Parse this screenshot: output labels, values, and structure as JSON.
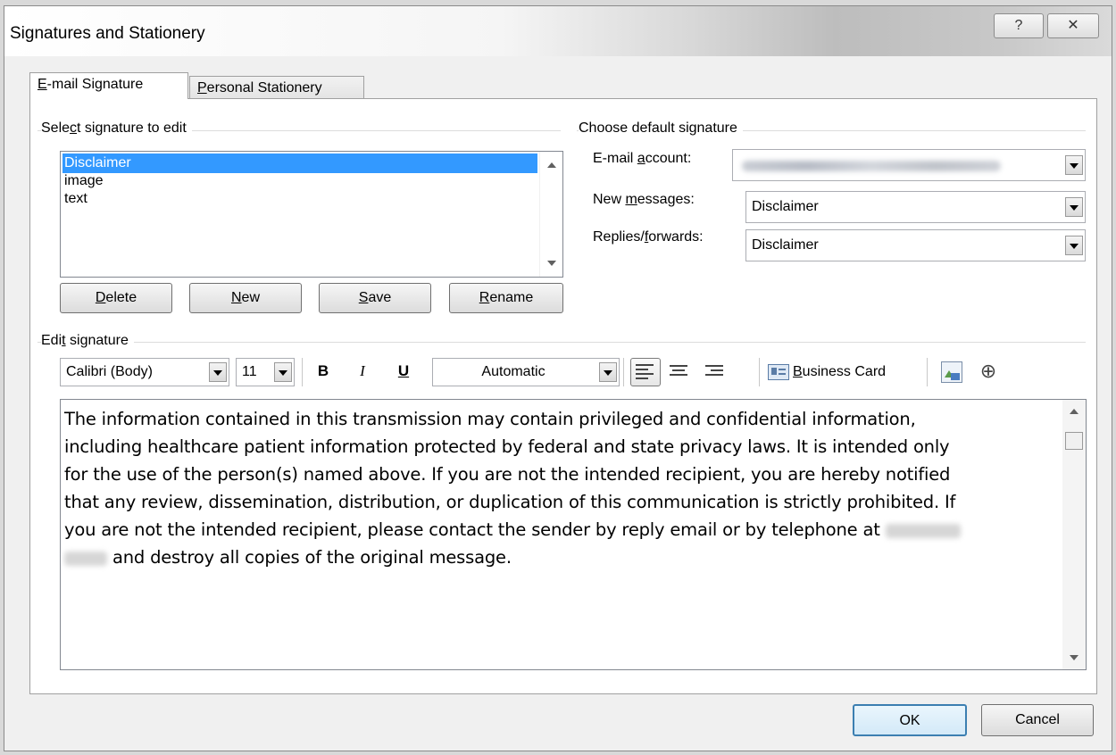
{
  "window": {
    "title": "Signatures and Stationery",
    "help_glyph": "?",
    "close_glyph": "✕"
  },
  "tabs": [
    {
      "label_accel": "E",
      "label_rest": "-mail Signature",
      "active": true
    },
    {
      "label_accel": "P",
      "label_rest": "ersonal Stationery",
      "active": false
    }
  ],
  "select_group": {
    "label_pre": "Sele",
    "label_accel": "c",
    "label_post": "t signature to edit",
    "items": [
      "Disclaimer",
      "image",
      "text"
    ],
    "selected_index": 0
  },
  "buttons": {
    "delete": {
      "accel": "D",
      "rest": "elete"
    },
    "new": {
      "accel": "N",
      "rest": "ew"
    },
    "save": {
      "accel": "S",
      "rest": "ave"
    },
    "rename": {
      "accel": "R",
      "rest": "ename"
    }
  },
  "default_group": {
    "label": "Choose default signature",
    "email_account_pre": "E-mail ",
    "email_account_accel": "a",
    "email_account_post": "ccount:",
    "new_messages_pre": "New ",
    "new_messages_accel": "m",
    "new_messages_post": "essages:",
    "new_messages_value": "Disclaimer",
    "replies_pre": "Replies/",
    "replies_accel": "f",
    "replies_post": "orwards:",
    "replies_value": "Disclaimer"
  },
  "edit_group": {
    "label_pre": "Edi",
    "label_accel": "t",
    "label_post": " signature",
    "font": "Calibri (Body)",
    "size": "11",
    "bold": "B",
    "italic": "I",
    "underline": "U",
    "color": "Automatic",
    "business_card_accel": "B",
    "business_card_rest": "usiness Card"
  },
  "signature_text": {
    "line1": "The information contained in this transmission may contain privileged and confidential information,",
    "line2": "including healthcare patient information protected by federal and state privacy laws. It is intended only",
    "line3": "for the use of the person(s) named above. If you are not the intended recipient, you are hereby notified",
    "line4": "that any review, dissemination, distribution, or duplication of this communication is strictly prohibited. If",
    "line5": "you are not the intended recipient, please contact the sender by reply email or by telephone at",
    "line6": "and destroy all copies of the original message."
  },
  "dialog_buttons": {
    "ok": "OK",
    "cancel": "Cancel"
  },
  "colors": {
    "selection": "#3399ff",
    "ok_border": "#3c7fb1"
  }
}
